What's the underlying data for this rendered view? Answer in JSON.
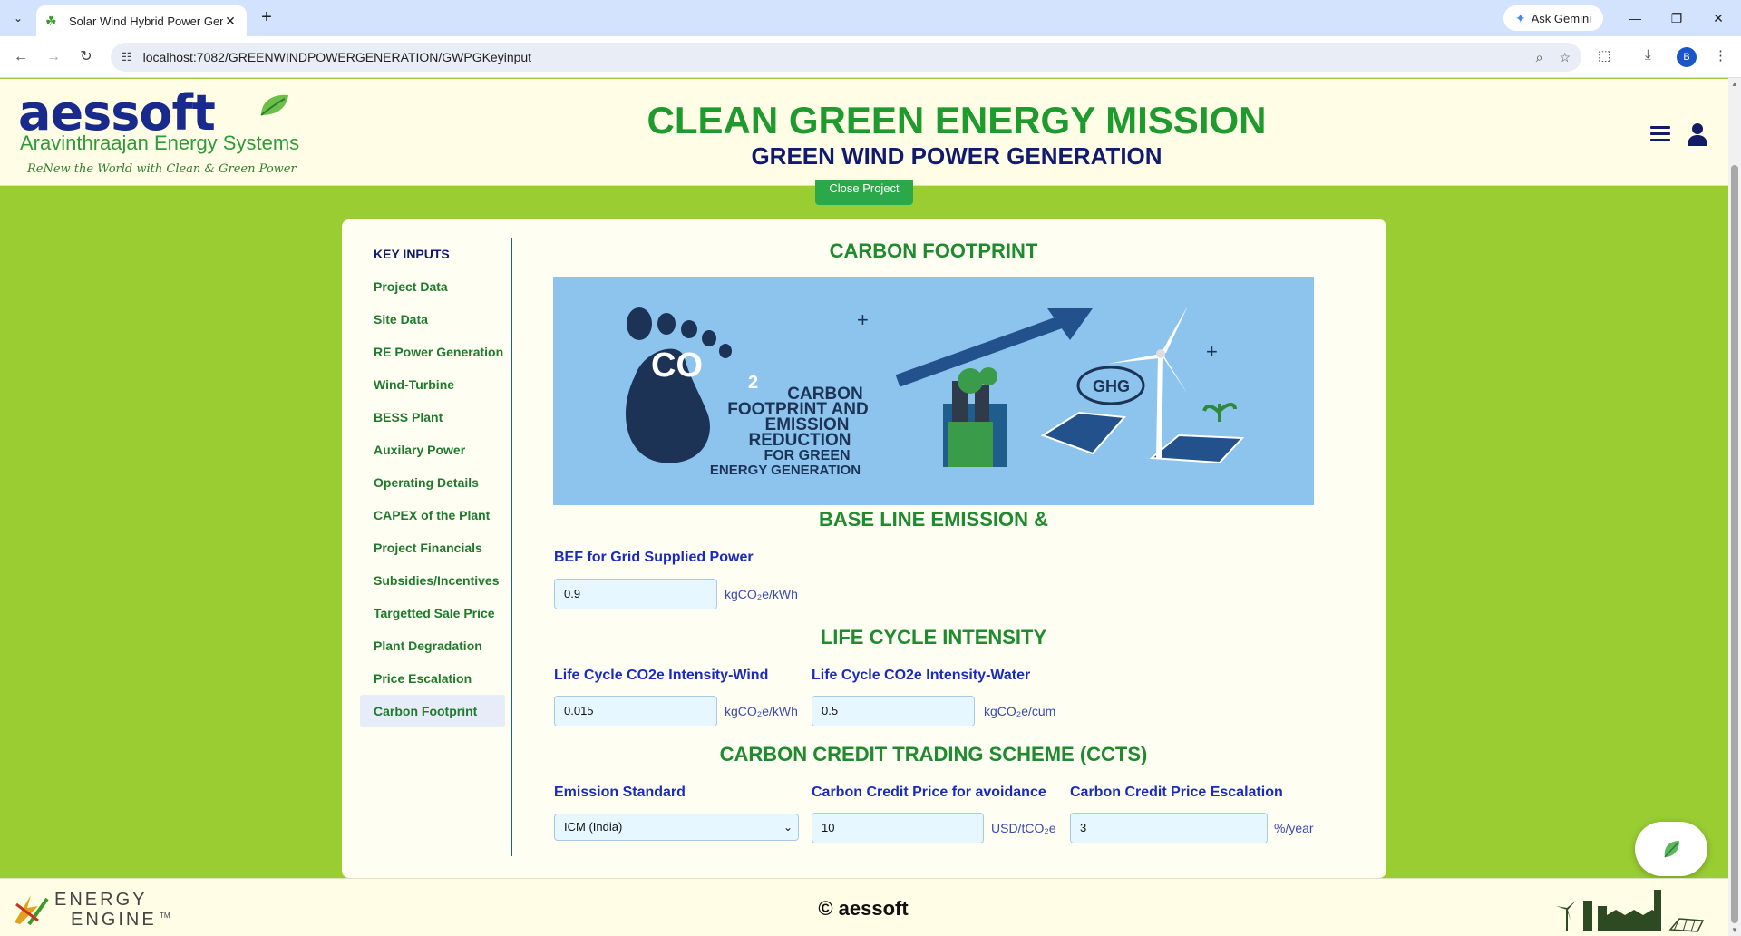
{
  "browser": {
    "tab_title": "Solar Wind Hybrid Power Gene",
    "new_tab_symbol": "+",
    "gemini_label": "Ask Gemini",
    "url": "localhost:7082/GREENWINDPOWERGENERATION/GWPGKeyinput",
    "profile_initial": "B"
  },
  "header": {
    "logo_text": "aessoft",
    "logo_subtitle": "Aravinthraajan Energy Systems",
    "logo_tagline": "ReNew the World with Clean & Green Power",
    "title": "CLEAN GREEN ENERGY MISSION",
    "subtitle": "GREEN WIND POWER GENERATION",
    "close_project_label": "Close Project"
  },
  "sidebar": {
    "heading": "KEY INPUTS",
    "items": [
      {
        "label": "Project Data"
      },
      {
        "label": "Site Data"
      },
      {
        "label": "RE Power Generation"
      },
      {
        "label": "Wind-Turbine"
      },
      {
        "label": "BESS Plant"
      },
      {
        "label": "Auxilary Power"
      },
      {
        "label": "Operating Details"
      },
      {
        "label": "CAPEX of the Plant"
      },
      {
        "label": "Project Financials"
      },
      {
        "label": "Subsidies/Incentives"
      },
      {
        "label": "Targetted Sale Price"
      },
      {
        "label": "Plant Degradation"
      },
      {
        "label": "Price Escalation"
      },
      {
        "label": "Carbon Footprint"
      }
    ],
    "active_item": "Carbon Footprint"
  },
  "main": {
    "section_title": "CARBON FOOTPRINT",
    "banner": {
      "co2": "CO",
      "co2_sub": "2",
      "ghg": "GHG",
      "line1": "CARBON",
      "line2": "FOOTPRINT AND",
      "line3": "EMISSION",
      "line4": "REDUCTION",
      "line5": "FOR GREEN",
      "line6": "ENERGY GENERATION"
    },
    "baseline": {
      "title": "BASE LINE EMISSION &",
      "bef_label": "BEF for Grid Supplied Power",
      "bef_value": "0.9",
      "bef_unit": "kgCO₂e/kWh"
    },
    "lifecycle": {
      "title": "LIFE CYCLE INTENSITY",
      "wind_label": "Life Cycle CO2e Intensity-Wind",
      "wind_value": "0.015",
      "wind_unit": "kgCO₂e/kWh",
      "water_label": "Life Cycle CO2e Intensity-Water",
      "water_value": "0.5",
      "water_unit": "kgCO₂e/cum"
    },
    "ccts": {
      "title": "CARBON CREDIT TRADING SCHEME (CCTS)",
      "standard_label": "Emission Standard",
      "standard_value": "ICM (India)",
      "price_label": "Carbon Credit Price for avoidance",
      "price_value": "10",
      "price_unit": "USD/tCO₂e",
      "escalation_label": "Carbon Credit Price Escalation",
      "escalation_value": "3",
      "escalation_unit": "%/year"
    }
  },
  "footer": {
    "brand_line1": "ENERGY",
    "brand_line2": "ENGINE",
    "brand_tm": "TM",
    "copyright": "© aessoft"
  },
  "colors": {
    "page_bg": "#9acd32",
    "header_bg": "#fffde6",
    "title_green": "#1f9a2e",
    "navy": "#101a6e",
    "label_blue": "#1a2abf",
    "input_bg": "#e6f7ff"
  }
}
